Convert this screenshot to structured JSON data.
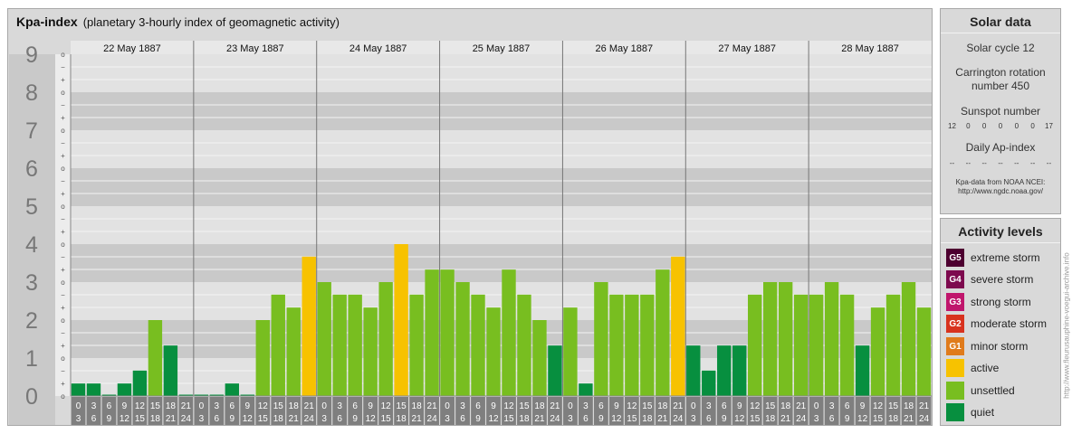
{
  "chart": {
    "title_bold": "Kpa-index",
    "title_rest": "(planetary 3-hourly index of geomagnetic activity)"
  },
  "chart_data": {
    "type": "bar",
    "title": "Kpa-index (planetary 3-hourly index of geomagnetic activity)",
    "ylim": [
      0,
      9
    ],
    "y_ticks": [
      "0",
      "1",
      "2",
      "3",
      "4",
      "5",
      "6",
      "7",
      "8",
      "9"
    ],
    "y_minor_marks": [
      "o",
      "+",
      "−"
    ],
    "days": [
      "22 May 1887",
      "23 May 1887",
      "24 May 1887",
      "25 May 1887",
      "26 May 1887",
      "27 May 1887",
      "28 May 1887"
    ],
    "hour_labels": [
      [
        "0",
        "3"
      ],
      [
        "3",
        "6"
      ],
      [
        "6",
        "9"
      ],
      [
        "9",
        "12"
      ],
      [
        "12",
        "15"
      ],
      [
        "15",
        "18"
      ],
      [
        "18",
        "21"
      ],
      [
        "21",
        "24"
      ]
    ],
    "values": [
      [
        0.33,
        0.33,
        0,
        0.33,
        0.67,
        2,
        1.33,
        0
      ],
      [
        0,
        0,
        0.33,
        0,
        2,
        2.67,
        2.33,
        3.67
      ],
      [
        3,
        2.67,
        2.67,
        2.33,
        3,
        4,
        2.67,
        3.33
      ],
      [
        3.33,
        3,
        2.67,
        2.33,
        3.33,
        2.67,
        2,
        1.33
      ],
      [
        2.33,
        0.33,
        3,
        2.67,
        2.67,
        2.67,
        3.33,
        3.67
      ],
      [
        1.33,
        0.67,
        1.33,
        1.33,
        2.67,
        3,
        3,
        2.67
      ],
      [
        2.67,
        3,
        2.67,
        1.33,
        2.33,
        2.67,
        3,
        2.33
      ]
    ],
    "grid": true
  },
  "solar": {
    "heading": "Solar data",
    "cycle": "Solar cycle 12",
    "carrington_line1": "Carrington rotation",
    "carrington_line2": "number 450",
    "sunspot_heading": "Sunspot number",
    "sunspot_values": [
      "12",
      "0",
      "0",
      "0",
      "0",
      "0",
      "17"
    ],
    "ap_heading": "Daily Ap-index",
    "ap_values": [
      "--",
      "--",
      "--",
      "--",
      "--",
      "--",
      "--"
    ],
    "source_line1": "Kpa-data from NOAA NCEI:",
    "source_line2": "http://www.ngdc.noaa.gov/"
  },
  "levels": {
    "heading": "Activity levels",
    "items": [
      {
        "code": "G5",
        "label": "extreme storm",
        "color": "#4d0030"
      },
      {
        "code": "G4",
        "label": "severe storm",
        "color": "#7d0a4e"
      },
      {
        "code": "G3",
        "label": "strong storm",
        "color": "#c0166c"
      },
      {
        "code": "G2",
        "label": "moderate storm",
        "color": "#d8321e"
      },
      {
        "code": "G1",
        "label": "minor storm",
        "color": "#e07b1c"
      },
      {
        "code": "",
        "label": "active",
        "color": "#f7c200"
      },
      {
        "code": "",
        "label": "unsettled",
        "color": "#78be20"
      },
      {
        "code": "",
        "label": "quiet",
        "color": "#078f3f"
      }
    ]
  },
  "watermark": "http://www.fleurusauphine-voegui-archive.info"
}
